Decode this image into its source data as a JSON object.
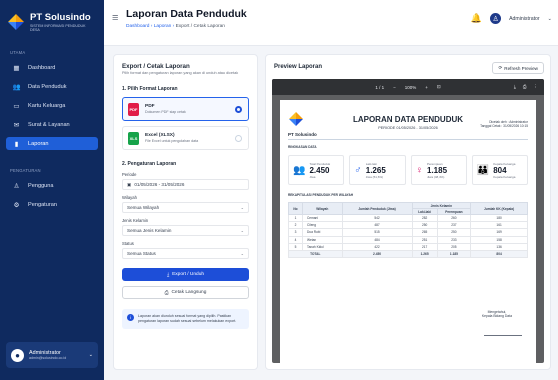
{
  "app": {
    "name": "PT Solusindo",
    "subtitle": "SISTEM INFORMASI PENDUDUK DESA"
  },
  "sidebar": {
    "section_main": "UTAMA",
    "section_admin": "PENGATURAN",
    "items": [
      {
        "label": "Dashboard",
        "icon": "grid-icon"
      },
      {
        "label": "Data Penduduk",
        "icon": "users-icon"
      },
      {
        "label": "Kartu Keluarga",
        "icon": "card-icon"
      },
      {
        "label": "Surat & Layanan",
        "icon": "mail-icon"
      },
      {
        "label": "Laporan",
        "icon": "chart-icon",
        "active": true
      }
    ],
    "admin_items": [
      {
        "label": "Pengguna",
        "icon": "user-icon"
      },
      {
        "label": "Pengaturan",
        "icon": "gear-icon"
      }
    ],
    "user": {
      "name": "Administrator",
      "email": "admin@solusindo.co.id"
    }
  },
  "header": {
    "title": "Laporan Data Penduduk",
    "breadcrumb": [
      "Dashboard",
      "Laporan",
      "Export / Cetak Laporan"
    ],
    "user": "Administrator"
  },
  "export": {
    "title": "Export / Cetak Laporan",
    "subtitle": "Pilih format dan pengaturan laporan yang akan di unduh atau dicetak",
    "step1": "1. Pilih Format Laporan",
    "formats": [
      {
        "name": "PDF",
        "desc": "Dokumen PDF siap cetak",
        "selected": true,
        "color": "#e11d48",
        "badge": "PDF"
      },
      {
        "name": "Excel (XLSX)",
        "desc": "File Excel untuk pengolahan data",
        "selected": false,
        "color": "#16a34a",
        "badge": "XLS"
      }
    ],
    "step2": "2. Pengaturan Laporan",
    "period_label": "Periode",
    "period_value": "01/05/2026 - 31/05/2026",
    "region_label": "Wilayah",
    "region_value": "Semua Wilayah",
    "gender_label": "Jenis Kelamin",
    "gender_value": "Semua Jenis Kelamin",
    "status_label": "Status",
    "status_value": "Semua Status",
    "export_button": "Export / Unduh",
    "print_button": "Cetak Langsung",
    "info": "Laporan akan diunduh sesuai format yang dipilih. Pastikan pengaturan laporan sudah sesuai sebelum melakukan export."
  },
  "preview": {
    "title": "Preview Laporan",
    "refresh": "Refresh Preview",
    "toolbar": {
      "page": "1 / 1",
      "zoom": "100%"
    },
    "doc": {
      "company": "PT Solusindo",
      "title": "LAPORAN DATA PENDUDUK",
      "period": "PERIODE 01/05/2026 - 31/05/2026",
      "meta1": "Dicetak oleh : Administrator",
      "meta2": "Tanggal Cetak : 31/05/2026 10:15",
      "summary_label": "RINGKASAN DATA",
      "cards": [
        {
          "label": "Total Penduduk",
          "value": "2.450",
          "sub": "Jiwa",
          "color": "#2563eb",
          "icon": "users-icon"
        },
        {
          "label": "Laki-laki",
          "value": "1.265",
          "sub": "Jiwa (51,6%)",
          "color": "#2563eb",
          "icon": "male-icon"
        },
        {
          "label": "Perempuan",
          "value": "1.185",
          "sub": "Jiwa (48,4%)",
          "color": "#db2777",
          "icon": "female-icon"
        },
        {
          "label": "Kepala Keluarga",
          "value": "804",
          "sub": "Kepala Keluarga",
          "color": "#f59e0b",
          "icon": "family-icon"
        }
      ],
      "table_label": "REKAPITULASI PENDUDUK PER WILAYAH",
      "table": {
        "headers": [
          "No",
          "Wilayah",
          "Jumlah Penduduk (Jiwa)",
          "Jenis Kelamin",
          "Jumlah KK (Kepala)"
        ],
        "subheaders": [
          "Laki-laki",
          "Perempuan"
        ],
        "rows": [
          [
            "1",
            "Cemani",
            "542",
            "282",
            "260",
            "180"
          ],
          [
            "2",
            "Cileng",
            "487",
            "250",
            "237",
            "161"
          ],
          [
            "3",
            "Dua Rubi",
            "515",
            "265",
            "250",
            "169"
          ],
          [
            "4",
            "Wetan",
            "484",
            "251",
            "233",
            "158"
          ],
          [
            "5",
            "Tanah Kidul",
            "422",
            "217",
            "205",
            "136"
          ]
        ],
        "total": [
          "TOTAL",
          "2.450",
          "1.265",
          "1.185",
          "804"
        ]
      },
      "signature": {
        "place": "Mengetahui,",
        "role": "Kepala Bidang Data"
      }
    }
  }
}
